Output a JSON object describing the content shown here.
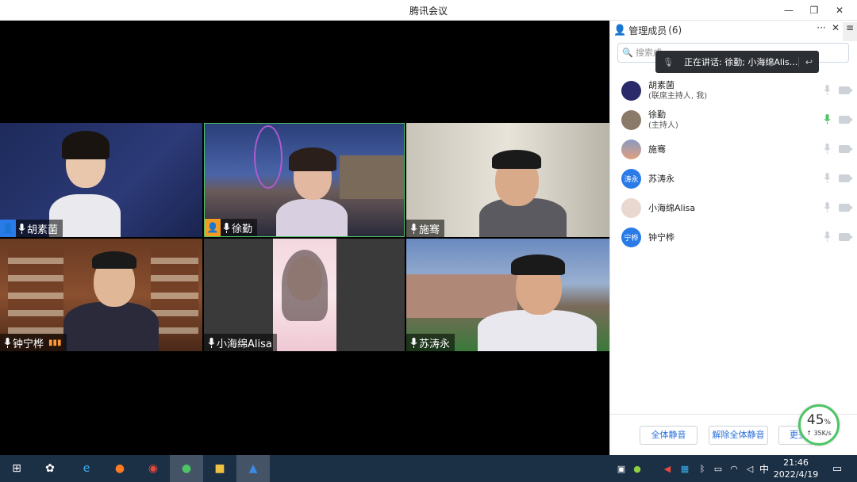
{
  "window": {
    "title": "腾讯会议"
  },
  "window_buttons": {
    "minimize": "—",
    "restore": "❐",
    "close": "✕"
  },
  "tiles": [
    {
      "name": "胡素菌",
      "host_icon": "host-badge-icon",
      "mic": "mic-icon"
    },
    {
      "name": "徐勤",
      "host_icon": "cohost-badge-icon",
      "mic": "mic-icon"
    },
    {
      "name": "施骞",
      "mic": "mic-icon"
    },
    {
      "name": "钟宁桦",
      "mic": "mic-icon",
      "extra": "audio-level-icon"
    },
    {
      "name": "小海绵Alisa",
      "mic": "mic-icon"
    },
    {
      "name": "苏涛永",
      "mic": "mic-icon"
    }
  ],
  "panel": {
    "title": "管理成员",
    "count": "(6)",
    "search_placeholder": "搜索成",
    "speaking": "正在讲话: 徐勤; 小海绵Alis...",
    "members": [
      {
        "name": "胡素菌",
        "role": "(联席主持人, 我)",
        "avatar_text": "",
        "mic_active": false
      },
      {
        "name": "徐勤",
        "role": "(主持人)",
        "avatar_text": "",
        "mic_active": true
      },
      {
        "name": "施骞",
        "role": "",
        "avatar_text": "",
        "mic_active": false
      },
      {
        "name": "苏涛永",
        "role": "",
        "avatar_text": "涛永",
        "mic_active": false
      },
      {
        "name": "小海绵Alisa",
        "role": "",
        "avatar_text": "",
        "mic_active": false
      },
      {
        "name": "钟宁桦",
        "role": "",
        "avatar_text": "宁桦",
        "mic_active": false
      }
    ],
    "buttons": {
      "mute_all": "全体静音",
      "unmute_all": "解除全体静音",
      "more": "更多"
    }
  },
  "network": {
    "percent": "45",
    "percent_unit": "%",
    "speed": "↑ 35K/s",
    "level": 0.45
  },
  "taskbar": {
    "time": "21:46",
    "date": "2022/4/19",
    "ime": "中"
  },
  "colors": {
    "accent": "#2a6fdb",
    "taskbar": "#1b2f45",
    "active_mic": "#4cc565"
  }
}
